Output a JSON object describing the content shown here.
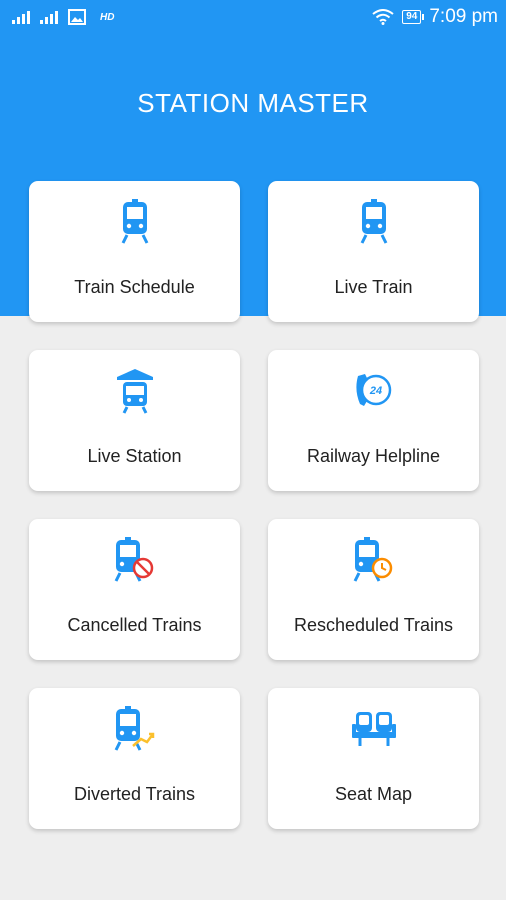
{
  "status_bar": {
    "hd_label": "HD",
    "battery": "94",
    "time": "7:09 pm"
  },
  "header": {
    "title": "STATION MASTER",
    "color": "#2196f3"
  },
  "menu": [
    {
      "label": "Train Schedule",
      "icon": "train-icon"
    },
    {
      "label": "Live Train",
      "icon": "train-icon"
    },
    {
      "label": "Live Station",
      "icon": "station-icon"
    },
    {
      "label": "Railway Helpline",
      "icon": "helpline-24-icon"
    },
    {
      "label": "Cancelled Trains",
      "icon": "cancelled-train-icon"
    },
    {
      "label": "Rescheduled Trains",
      "icon": "rescheduled-train-icon"
    },
    {
      "label": "Diverted Trains",
      "icon": "diverted-train-icon"
    },
    {
      "label": "Seat Map",
      "icon": "seat-icon"
    }
  ],
  "colors": {
    "icon_blue": "#2196f3",
    "cancel_red": "#e53935",
    "reschedule_orange": "#fb8c00",
    "divert_yellow": "#fbc02d"
  }
}
